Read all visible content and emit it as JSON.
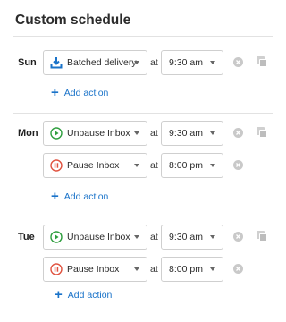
{
  "title": "Custom schedule",
  "colors": {
    "accent": "#1a73c9",
    "play": "#2e9e3e",
    "pause": "#e0523f"
  },
  "days": [
    {
      "day": "Sun",
      "rows": [
        {
          "action": "Batched delivery",
          "icon": "download-tray-icon",
          "time": "9:30 am"
        }
      ],
      "add_label": "Add action"
    },
    {
      "day": "Mon",
      "rows": [
        {
          "action": "Unpause Inbox",
          "icon": "play-circle-icon",
          "time": "9:30 am"
        },
        {
          "action": "Pause Inbox",
          "icon": "pause-circle-icon",
          "time": "8:00 pm"
        }
      ],
      "add_label": "Add action"
    },
    {
      "day": "Tue",
      "rows": [
        {
          "action": "Unpause Inbox",
          "icon": "play-circle-icon",
          "time": "9:30 am"
        },
        {
          "action": "Pause Inbox",
          "icon": "pause-circle-icon",
          "time": "8:00 pm"
        }
      ],
      "add_label": "Add action"
    }
  ],
  "at_label": "at"
}
